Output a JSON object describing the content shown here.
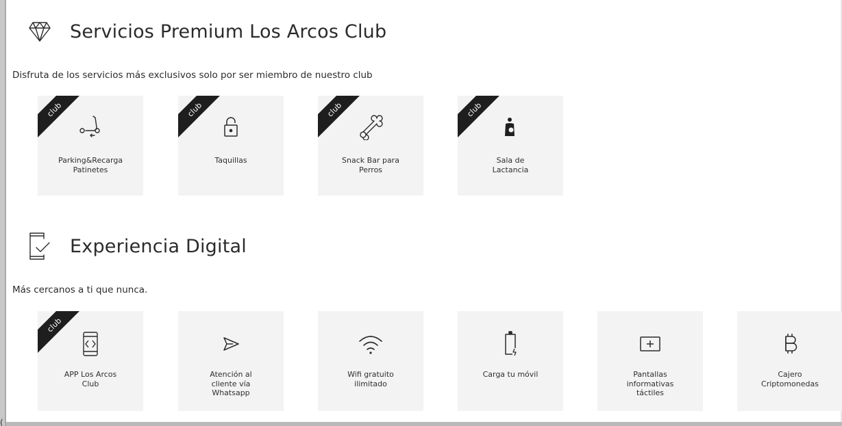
{
  "premium": {
    "title": "Servicios Premium Los Arcos Club",
    "subtitle": "Disfruta de los servicios más exclusivos solo por ser miembro de nuestro club",
    "icon": "diamond-icon",
    "cards": [
      {
        "label": "Parking&Recarga\nPatinetes",
        "icon": "scooter-icon",
        "ribbon": "club"
      },
      {
        "label": "Taquillas",
        "icon": "lock-icon",
        "ribbon": "club"
      },
      {
        "label": "Snack Bar para\nPerros",
        "icon": "bone-icon",
        "ribbon": "club"
      },
      {
        "label": "Sala de\nLactancia",
        "icon": "nursing-icon",
        "ribbon": "club"
      }
    ]
  },
  "digital": {
    "title": "Experiencia Digital",
    "subtitle": "Más cercanos a ti que nunca.",
    "icon": "phone-check-icon",
    "cards": [
      {
        "label": "APP Los Arcos\nClub",
        "icon": "app-code-icon",
        "ribbon": "club"
      },
      {
        "label": "Atención al\ncliente vía\nWhatsapp",
        "icon": "send-icon"
      },
      {
        "label": "Wifi gratuito\nilimitado",
        "icon": "wifi-icon"
      },
      {
        "label": "Carga tu móvil",
        "icon": "phone-charge-icon"
      },
      {
        "label": "Pantallas\ninformativas\ntáctiles",
        "icon": "touch-screen-icon"
      },
      {
        "label": "Cajero\nCriptomonedas",
        "icon": "bitcoin-icon"
      }
    ]
  },
  "colors": {
    "card_bg": "#f3f3f3",
    "ribbon": "#1e1e1e",
    "text": "#2b2b2b"
  }
}
